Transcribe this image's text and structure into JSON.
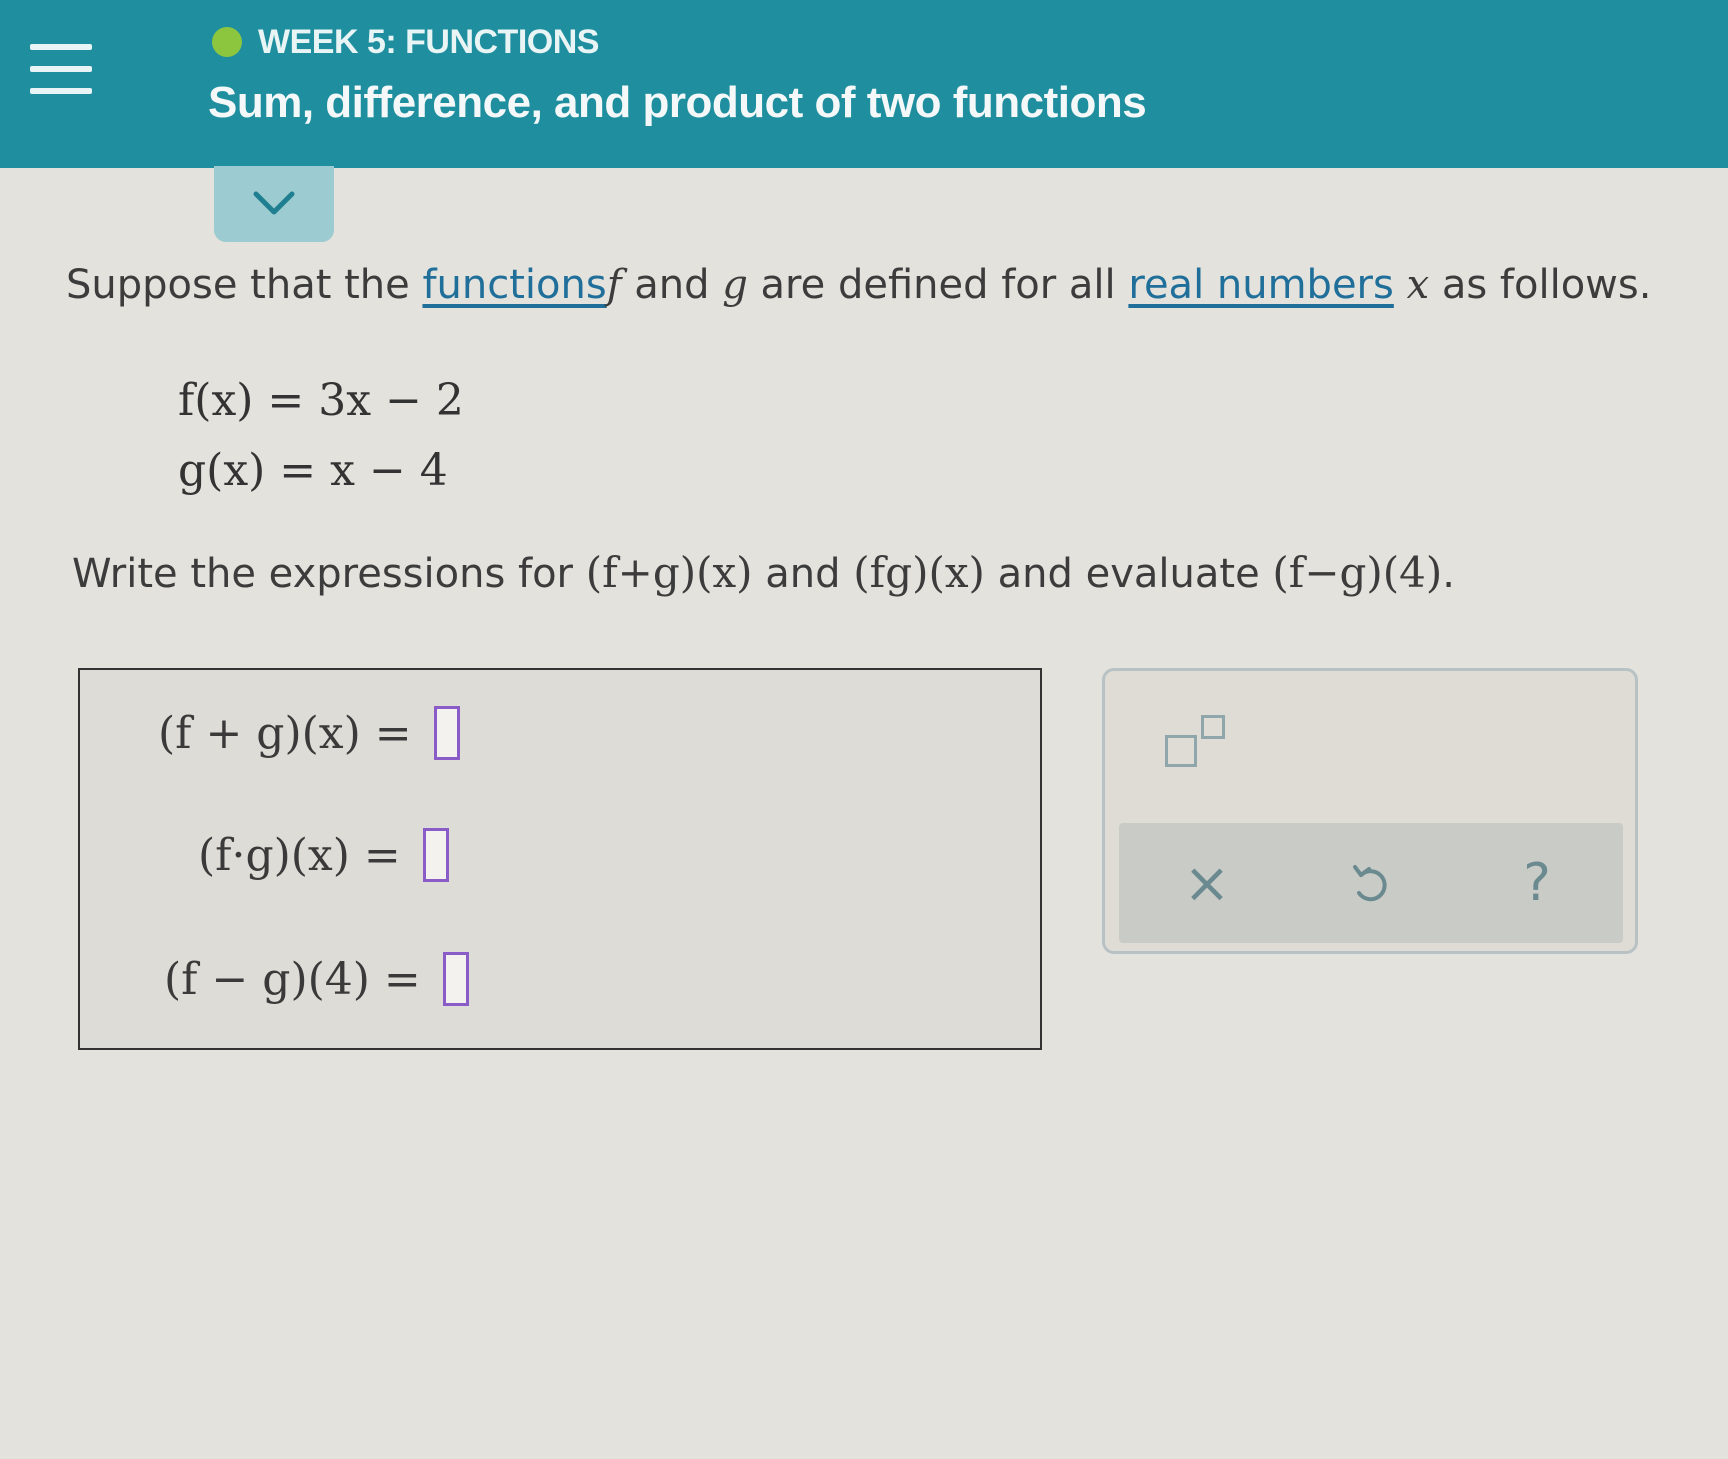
{
  "header": {
    "week_label": "WEEK 5: FUNCTIONS",
    "topic_title": "Sum, difference, and product of two functions",
    "status_color": "#8cc63f",
    "bar_color": "#1f8fa0"
  },
  "intro": {
    "p1": "Suppose that the ",
    "link_functions": "functions",
    "f": "f",
    "p2": " and ",
    "g": "g",
    "p3": " are defined for all ",
    "link_real": "real numbers",
    "x": "x",
    "p4": " as follows."
  },
  "definitions": {
    "f_def": "f(x) = 3x − 2",
    "g_def": "g(x) = x − 4"
  },
  "task": {
    "p1": "Write the expressions for ",
    "e1": "(f+g)(x)",
    "p2": " and ",
    "e2": "(fg)(x)",
    "p3": " and evaluate ",
    "e3": "(f−g)(4)",
    "p4": "."
  },
  "answers": [
    {
      "label": "(f + g)(x) =",
      "value": ""
    },
    {
      "label": "(f·g)(x) =",
      "value": ""
    },
    {
      "label": "(f − g)(4) =",
      "value": ""
    }
  ],
  "tools": {
    "exponent_icon": "exponent-template-icon",
    "clear_label": "×",
    "undo_icon": "undo-icon",
    "help_label": "?"
  }
}
